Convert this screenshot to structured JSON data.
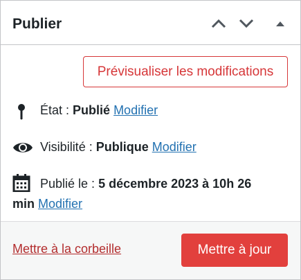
{
  "box": {
    "title": "Publier",
    "move_up_icon": "chevron-up-icon",
    "move_down_icon": "chevron-down-icon",
    "toggle_icon": "triangle-up-icon"
  },
  "preview": {
    "label": "Prévisualiser les modifications"
  },
  "status": {
    "icon": "pin-icon",
    "label": "État : ",
    "value": "Publié",
    "edit": "Modifier"
  },
  "visibility": {
    "icon": "eye-icon",
    "label": "Visibilité : ",
    "value": "Publique",
    "edit": "Modifier"
  },
  "date": {
    "icon": "calendar-icon",
    "label": "Publié le : ",
    "value_line1": "5 décembre 2023 à 10h 26",
    "value_line2": "min",
    "edit": "Modifier"
  },
  "actions": {
    "trash": "Mettre à la corbeille",
    "update": "Mettre à jour"
  },
  "colors": {
    "danger": "#d63638",
    "primary_button": "#e2403d",
    "link": "#2271b1",
    "border": "#c3c4c7"
  }
}
